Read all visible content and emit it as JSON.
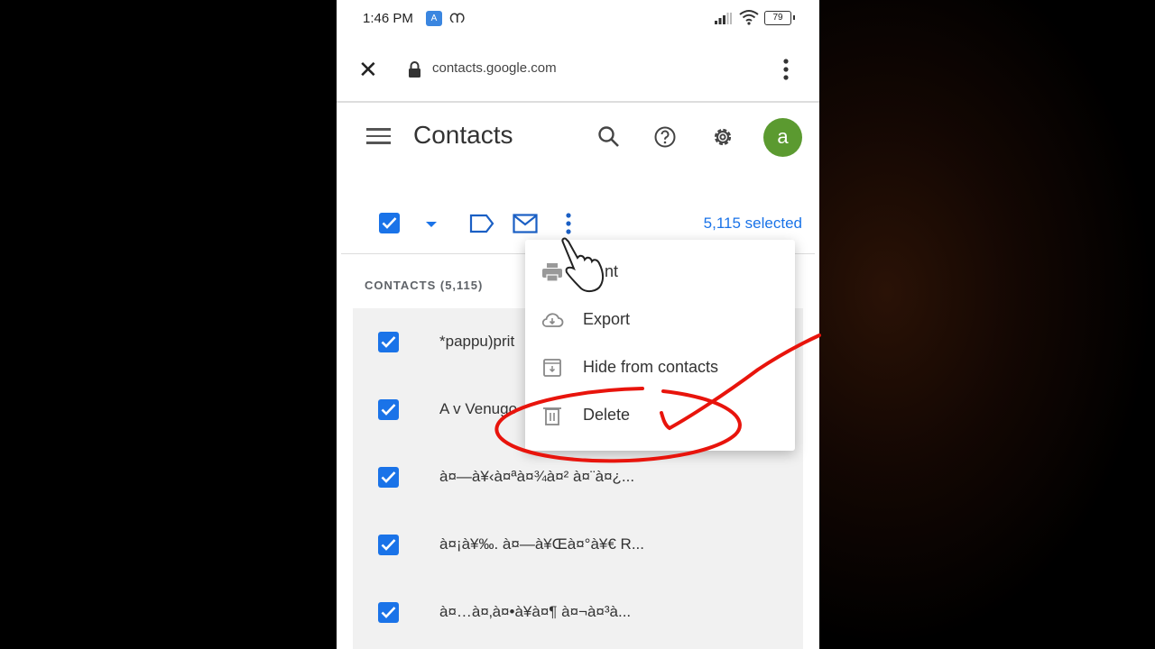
{
  "status_bar": {
    "time": "1:46 PM",
    "app_badge": "A",
    "app_glyph": "ന",
    "battery": "79"
  },
  "browser": {
    "url": "contacts.google.com",
    "close_icon": "close-icon",
    "lock_icon": "lock-icon",
    "menu_icon": "more-vert-icon"
  },
  "header": {
    "title": "Contacts",
    "avatar_letter": "a",
    "colors": {
      "avatar": "#5b9a30"
    }
  },
  "toolbar": {
    "selected_text": "5,115 selected",
    "colors": {
      "accent": "#1a73e8"
    }
  },
  "list": {
    "section_label": "CONTACTS (5,115)",
    "contacts": [
      {
        "name": "*pappu)prit",
        "checked": true
      },
      {
        "name": "A v Venugo",
        "checked": true
      },
      {
        "name": "à¤—à¥‹à¤ªà¤¾à¤² à¤¨à¤¿...",
        "checked": true
      },
      {
        "name": "à¤¡à¥‰. à¤—à¥Œà¤°à¥€ R...",
        "checked": true
      },
      {
        "name": "à¤…à¤‚à¤•à¥à¤¶ à¤¬à¤³à...",
        "checked": true
      }
    ]
  },
  "menu": {
    "items": [
      {
        "label": "Print",
        "visible_label": "nt",
        "icon": "print-icon"
      },
      {
        "label": "Export",
        "icon": "cloud-download-icon"
      },
      {
        "label": "Hide from contacts",
        "icon": "archive-icon"
      },
      {
        "label": "Delete",
        "icon": "trash-icon"
      }
    ]
  },
  "annotation": {
    "color": "#e8140c",
    "description": "red circle and checkmark around Delete"
  }
}
